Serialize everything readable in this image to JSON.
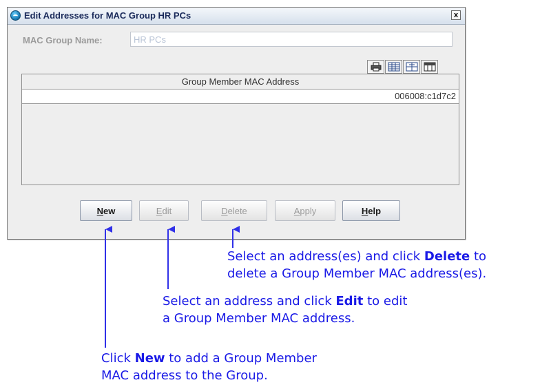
{
  "dialog": {
    "title": "Edit Addresses for MAC Group HR PCs",
    "close_label": "x",
    "mac_group_name_label": "MAC Group Name:",
    "mac_group_name_value": "HR PCs",
    "table": {
      "column_header": "Group Member MAC Address",
      "rows": [
        "006008:c1d7c2"
      ]
    },
    "buttons": {
      "new": {
        "first": "N",
        "rest": "ew"
      },
      "edit": {
        "first": "E",
        "rest": "dit"
      },
      "delete": {
        "first": "D",
        "rest": "elete"
      },
      "apply": {
        "first": "A",
        "rest": "pply"
      },
      "help": {
        "first": "H",
        "rest": "elp"
      }
    }
  },
  "annotations": {
    "delete": {
      "line1_pre": "Select an address(es) and click ",
      "line1_bold": "Delete",
      "line1_post": " to",
      "line2": "delete a Group Member MAC address(es)."
    },
    "edit": {
      "line1_pre": "Select an address and click ",
      "line1_bold": "Edit",
      "line1_post": " to edit",
      "line2": "a Group Member MAC address."
    },
    "new": {
      "line1_pre": "Click ",
      "line1_bold": "New",
      "line1_post": " to add a Group Member",
      "line2": "MAC address to the Group."
    }
  },
  "colors": {
    "annotation": "#1a1ae6"
  }
}
